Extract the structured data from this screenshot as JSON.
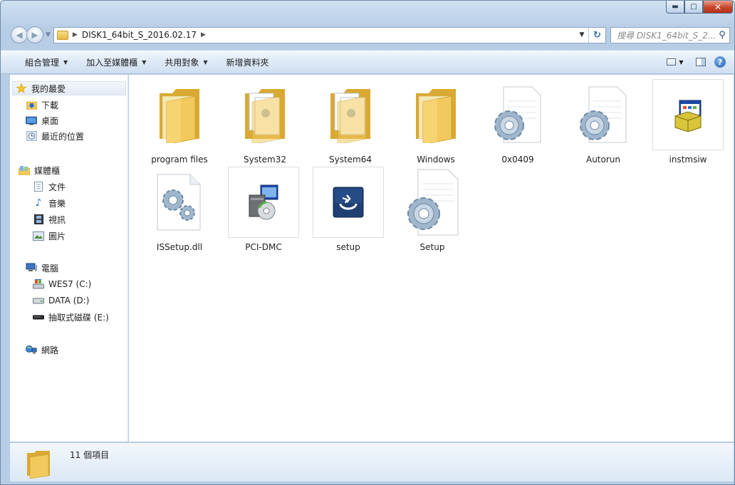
{
  "window": {
    "min_glyph": "▬",
    "max_glyph": "□",
    "close_glyph": "✕"
  },
  "address": {
    "path_segment": "DISK1_64bit_S_2016.02.17",
    "search_placeholder": "搜尋 DISK1_64bit_S_2..."
  },
  "toolbar": {
    "organize": "組合管理",
    "add_to_library": "加入至媒體櫃",
    "share": "共用對象",
    "new_folder": "新增資料夾"
  },
  "nav": {
    "favorites": "我的最愛",
    "downloads": "下載",
    "desktop": "桌面",
    "recent": "最近的位置",
    "libraries": "媒體櫃",
    "documents": "文件",
    "music": "音樂",
    "videos": "視訊",
    "pictures": "圖片",
    "computer": "電腦",
    "drive_c": "WES7 (C:)",
    "drive_d": "DATA (D:)",
    "drive_e": "抽取式磁碟 (E:)",
    "network": "網路"
  },
  "items": [
    {
      "name": "program files",
      "type": "folder"
    },
    {
      "name": "System32",
      "type": "folder-docs"
    },
    {
      "name": "System64",
      "type": "folder-docs"
    },
    {
      "name": "Windows",
      "type": "folder"
    },
    {
      "name": "0x0409",
      "type": "config"
    },
    {
      "name": "Autorun",
      "type": "config"
    },
    {
      "name": "instmsiw",
      "type": "installer"
    },
    {
      "name": "ISSetup.dll",
      "type": "dll"
    },
    {
      "name": "PCI-DMC",
      "type": "setup-exe"
    },
    {
      "name": "setup",
      "type": "app"
    },
    {
      "name": "Setup",
      "type": "config"
    }
  ],
  "status": {
    "count_text": "11 個項目"
  },
  "colors": {
    "folder": "#f1c95d",
    "folder_dark": "#d9a933",
    "selection": "#e3ebf4",
    "gear": "#9fb6cc"
  }
}
